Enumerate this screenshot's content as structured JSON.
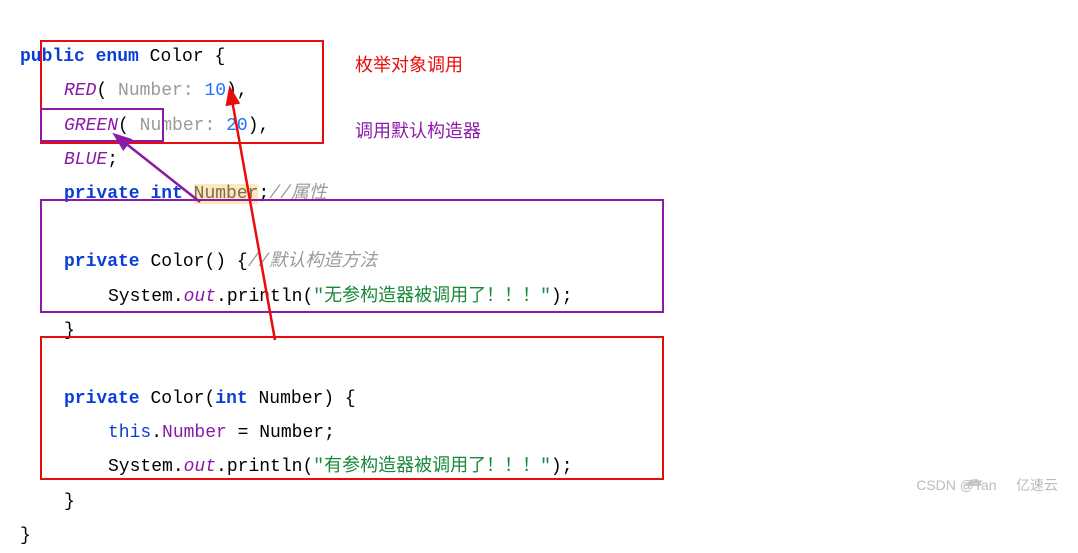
{
  "code": {
    "line1_public": "public",
    "line1_enum": "enum",
    "line1_name": "Color",
    "line1_open": "{",
    "red_const": "RED",
    "hint_label": "Number:",
    "red_num": "10",
    "green_const": "GREEN",
    "green_num": "20",
    "blue_const": "BLUE",
    "semi": ";",
    "comma": ",",
    "paren_open": "(",
    "paren_close": ")",
    "priv": "private",
    "int_kw": "int",
    "field_name": "Number",
    "field_comment": "//属性",
    "ctor0_decl_name": "Color",
    "ctor0_comment": "//默认构造方法",
    "sysout_system": "System",
    "sysout_out": "out",
    "sysout_println": "println",
    "ctor0_msg": "\"无参构造器被调用了！！！\"",
    "ctor1_param_type": "int",
    "ctor1_param_name": "Number",
    "this_kw": "this",
    "assign_field": "Number",
    "assign_rhs": "Number",
    "ctor1_msg": "\"有参构造器被调用了！！！\"",
    "brace_open": "{",
    "brace_close": "}"
  },
  "annotations": {
    "enum_call": "枚举对象调用",
    "default_ctor_call": "调用默认构造器"
  },
  "watermark": {
    "csdn": "CSDN @Tan",
    "yisu": "亿速云"
  }
}
